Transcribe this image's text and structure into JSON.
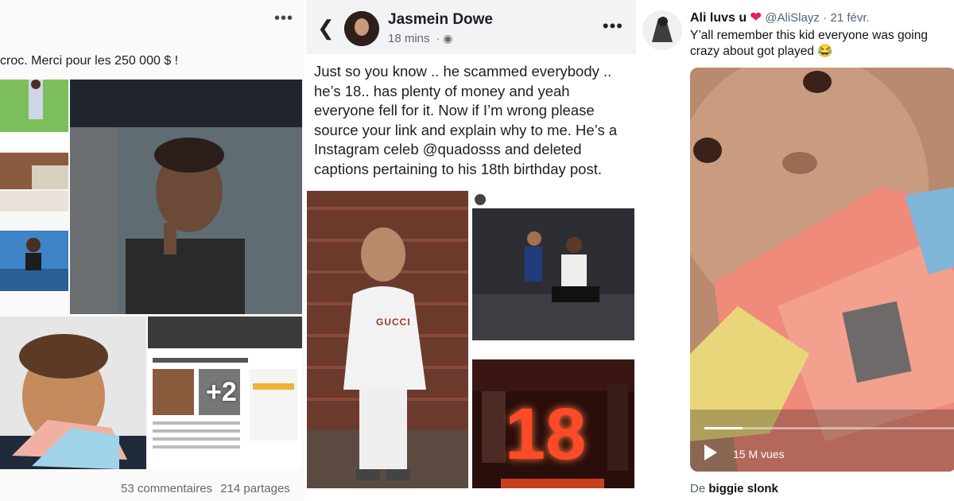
{
  "left_post": {
    "caption": "croc. Merci pour les 250 000 $ !",
    "more_icon": "more-horizontal-icon",
    "extra_photos": "+2",
    "comments": "53 commentaires",
    "shares": "214 partages"
  },
  "middle_post": {
    "author": "Jasmein Dowe",
    "time": "18 mins",
    "visibility_icon": "globe-icon",
    "body": "Just so you know .. he scammed everybody .. he’s 18.. has plenty of money and yeah everyone fell for it. Now if I’m wrong please source your link and explain why to me. He’s a Instagram celeb @quadosss and deleted captions pertaining to his 18th birthday post.",
    "insta_handle": "quadosss",
    "cake_number": "18",
    "hoodie_text": "GUCCI"
  },
  "right_tweet": {
    "name": "Ali luvs u",
    "heart": "❤",
    "handle": "@AliSlayz",
    "date": "21 févr.",
    "text": "Y’all remember this kid everyone was going crazy about got played 😂",
    "views": "15 M vues",
    "source_prefix": "De",
    "source_name": "biggie slonk"
  }
}
